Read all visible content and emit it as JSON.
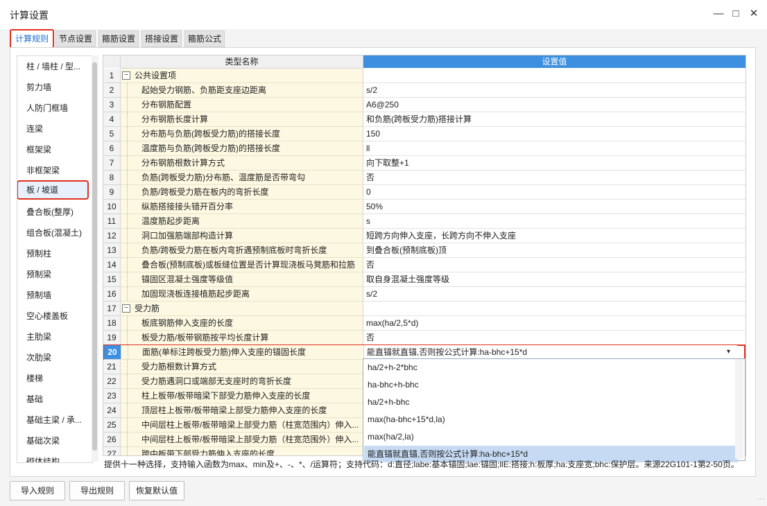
{
  "window": {
    "title": "计算设置"
  },
  "tabs": [
    "计算规则",
    "节点设置",
    "箍筋设置",
    "搭接设置",
    "箍筋公式"
  ],
  "left_list": [
    "柱 / 墙柱 / 型...",
    "剪力墙",
    "人防门框墙",
    "连梁",
    "框架梁",
    "非框架梁",
    "板 / 坡道",
    "叠合板(整厚)",
    "组合板(混凝土)",
    "预制柱",
    "预制梁",
    "预制墙",
    "空心楼盖板",
    "主肋梁",
    "次肋梁",
    "楼梯",
    "基础",
    "基础主梁 / 承...",
    "基础次梁",
    "砌体结构"
  ],
  "grid": {
    "headers": {
      "name": "类型名称",
      "value": "设置值"
    },
    "rows": [
      {
        "n": "1",
        "name": "公共设置项",
        "value": "",
        "group": true
      },
      {
        "n": "2",
        "name": "起始受力钢筋、负筋距支座边距离",
        "value": "s/2"
      },
      {
        "n": "3",
        "name": "分布钢筋配置",
        "value": "A6@250"
      },
      {
        "n": "4",
        "name": "分布钢筋长度计算",
        "value": "和负筋(跨板受力筋)搭接计算"
      },
      {
        "n": "5",
        "name": "分布筋与负筋(跨板受力筋)的搭接长度",
        "value": "150"
      },
      {
        "n": "6",
        "name": "温度筋与负筋(跨板受力筋)的搭接长度",
        "value": "ll"
      },
      {
        "n": "7",
        "name": "分布钢筋根数计算方式",
        "value": "向下取整+1"
      },
      {
        "n": "8",
        "name": "负筋(跨板受力筋)分布筋、温度筋是否带弯勾",
        "value": "否"
      },
      {
        "n": "9",
        "name": "负筋/跨板受力筋在板内的弯折长度",
        "value": "0"
      },
      {
        "n": "10",
        "name": "纵筋搭接接头错开百分率",
        "value": "50%"
      },
      {
        "n": "11",
        "name": "温度筋起步距离",
        "value": "s"
      },
      {
        "n": "12",
        "name": "洞口加强筋端部构造计算",
        "value": "短跨方向伸入支座，长跨方向不伸入支座"
      },
      {
        "n": "13",
        "name": "负筋/跨板受力筋在板内弯折遇预制底板时弯折长度",
        "value": "到叠合板(预制底板)顶"
      },
      {
        "n": "14",
        "name": "叠合板(预制底板)或板缝位置是否计算现浇板马凳筋和拉筋",
        "value": "否"
      },
      {
        "n": "15",
        "name": "锚固区混凝土强度等级值",
        "value": "取自身混凝土强度等级"
      },
      {
        "n": "16",
        "name": "加固现浇板连接植筋起步距离",
        "value": "s/2"
      },
      {
        "n": "17",
        "name": "受力筋",
        "value": "",
        "group": true
      },
      {
        "n": "18",
        "name": "板底钢筋伸入支座的长度",
        "value": "max(ha/2,5*d)"
      },
      {
        "n": "19",
        "name": "板受力筋/板带钢筋按平均长度计算",
        "value": "否"
      },
      {
        "n": "20",
        "name": "面筋(单标注跨板受力筋)伸入支座的锚固长度",
        "value": "能直锚就直锚,否则按公式计算:ha-bhc+15*d",
        "selected": true
      },
      {
        "n": "21",
        "name": "受力筋根数计算方式",
        "value": ""
      },
      {
        "n": "22",
        "name": "受力筋遇洞口或端部无支座时的弯折长度",
        "value": ""
      },
      {
        "n": "23",
        "name": "柱上板带/板带暗梁下部受力筋伸入支座的长度",
        "value": ""
      },
      {
        "n": "24",
        "name": "顶层柱上板带/板带暗梁上部受力筋伸入支座的长度",
        "value": ""
      },
      {
        "n": "25",
        "name": "中间层柱上板带/板带暗梁上部受力筋（柱宽范围内）伸入...",
        "value": ""
      },
      {
        "n": "26",
        "name": "中间层柱上板带/板带暗梁上部受力筋（柱宽范围外）伸入...",
        "value": ""
      },
      {
        "n": "27",
        "name": "跨中板带下部受力筋伸入支座的长度",
        "value": ""
      }
    ]
  },
  "dropdown": {
    "options": [
      "ha/2+h-2*bhc",
      "ha-bhc+h-bhc",
      "ha/2+h-bhc",
      "max(ha-bhc+15*d,la)",
      "max(ha/2,la)",
      "能直锚就直锚,否则按公式计算:ha-bhc+15*d"
    ],
    "selected_index": 5
  },
  "hint": "提供十一种选择，支持输入函数为max、min及+、-、*、/运算符；支持代码：d:直径;labe:基本锚固;lae:锚固;llE:搭接;h:板厚;ha:支座宽;bhc:保护层。来源22G101-1第2-50页。",
  "buttons": {
    "import": "导入规则",
    "export": "导出规则",
    "reset": "恢复默认值"
  },
  "colors": {
    "accent": "#1b6fd0",
    "highlight": "#e0301e",
    "name_bg": "#fdf8e1",
    "header_value_bg": "#3d8fe0"
  }
}
